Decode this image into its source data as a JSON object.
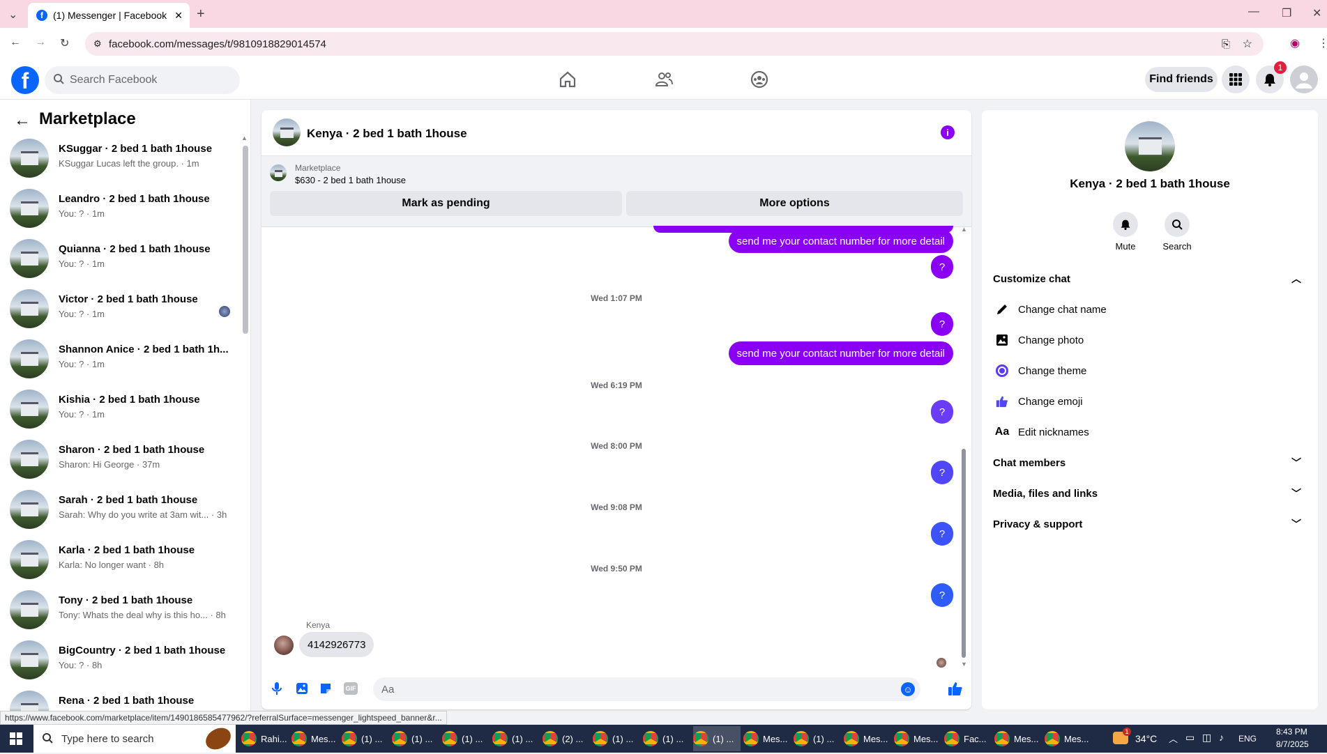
{
  "browser": {
    "tab_title": "(1) Messenger | Facebook",
    "url": "facebook.com/messages/t/9810918829014574",
    "status_url": "https://www.facebook.com/marketplace/item/1490186585477962/?referralSurface=messenger_lightspeed_banner&r..."
  },
  "header": {
    "search_placeholder": "Search Facebook",
    "find_friends": "Find friends",
    "notif_count": "1"
  },
  "sidebar": {
    "title": "Marketplace",
    "conversations": [
      {
        "name": "KSuggar · 2 bed 1 bath 1house",
        "preview": "KSuggar Lucas left the group. · 1m"
      },
      {
        "name": "Leandro · 2 bed 1 bath 1house",
        "preview": "You: ? · 1m"
      },
      {
        "name": "Quianna · 2 bed 1 bath 1house",
        "preview": "You: ? · 1m"
      },
      {
        "name": "Victor · 2 bed 1 bath 1house",
        "preview": "You: ? · 1m"
      },
      {
        "name": "Shannon Anice · 2 bed 1 bath 1h...",
        "preview": "You: ? · 1m"
      },
      {
        "name": "Kishia · 2 bed 1 bath 1house",
        "preview": "You: ? · 1m"
      },
      {
        "name": "Sharon · 2 bed 1 bath 1house",
        "preview": "Sharon: Hi George · 37m"
      },
      {
        "name": "Sarah · 2 bed 1 bath 1house",
        "preview": "Sarah: Why do you write at 3am wit... · 3h"
      },
      {
        "name": "Karla · 2 bed 1 bath 1house",
        "preview": "Karla: No longer want · 8h"
      },
      {
        "name": "Tony · 2 bed 1 bath 1house",
        "preview": "Tony: Whats the deal why is this ho... · 8h"
      },
      {
        "name": "BigCountry · 2 bed 1 bath 1house",
        "preview": "You: ? · 8h"
      },
      {
        "name": "Rena · 2 bed 1 bath 1house",
        "preview": ""
      }
    ]
  },
  "chat": {
    "title": "Kenya · 2 bed 1 bath 1house",
    "banner_label": "Marketplace",
    "banner_listing": "$630 - 2 bed 1 bath 1house",
    "mark_pending": "Mark as pending",
    "more_options": "More options",
    "msg_contact": "send me your contact number for more detail",
    "msg_q": "?",
    "timestamps": [
      "Wed 1:07 PM",
      "Wed 6:19 PM",
      "Wed 8:00 PM",
      "Wed 9:08 PM",
      "Wed 9:50 PM"
    ],
    "sender": "Kenya",
    "incoming": "4142926773",
    "input_placeholder": "Aa"
  },
  "details": {
    "name": "Kenya · 2 bed 1 bath 1house",
    "mute": "Mute",
    "search": "Search",
    "customize": "Customize chat",
    "change_name": "Change chat name",
    "change_photo": "Change photo",
    "change_theme": "Change theme",
    "change_emoji": "Change emoji",
    "edit_nicknames": "Edit nicknames",
    "chat_members": "Chat members",
    "media": "Media, files and links",
    "privacy": "Privacy & support"
  },
  "taskbar": {
    "search": "Type here to search",
    "items": [
      "Rahi...",
      "Mes...",
      "(1) ...",
      "(1) ...",
      "(1) ...",
      "(1) ...",
      "(2) ...",
      "(1) ...",
      "(1) ...",
      "(1) ...",
      "Mes...",
      "(1) ...",
      "Mes...",
      "Mes...",
      "Fac...",
      "Mes...",
      "Mes..."
    ],
    "temp": "34°C",
    "lang": "ENG",
    "time": "8:43 PM",
    "date": "8/7/2025",
    "weather_badge": "1"
  },
  "colors": {
    "accent": "#0866ff",
    "bubble_purple": "#8a00f5",
    "bubble_blue": "#2f5cf9",
    "chrome_tab": "#f9d8e4"
  }
}
